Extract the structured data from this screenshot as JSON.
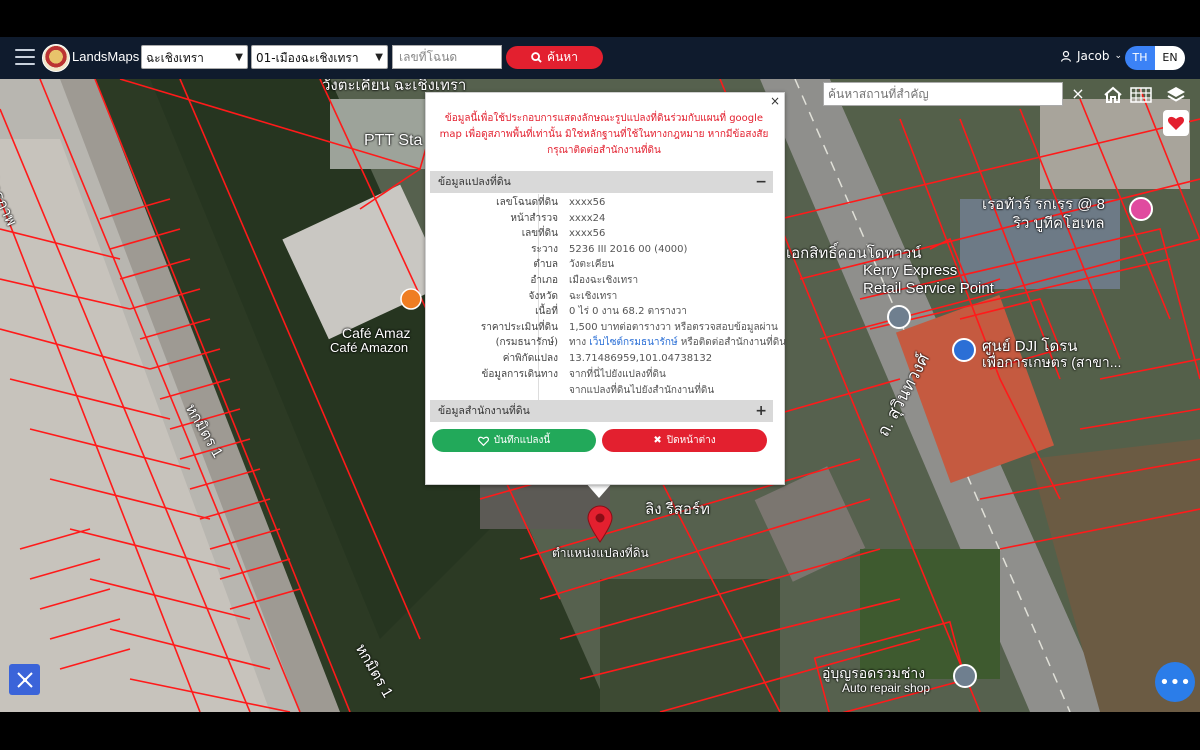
{
  "app": {
    "name": "LandsMaps"
  },
  "toolbar": {
    "province": "ฉะเชิงเทรา",
    "district": "01-เมืองฉะเชิงเทรา",
    "deed_placeholder": "เลขที่โฉนด",
    "search_label": "ค้นหา"
  },
  "user": {
    "name": "Jacob"
  },
  "language": {
    "th": "TH",
    "en": "EN",
    "active": "TH"
  },
  "map_controls": {
    "place_search_placeholder": "ค้นหาสถานที่สำคัญ",
    "clear": "×",
    "chat_label": "•••"
  },
  "map_labels": [
    "วังตะเคียน ฉะเชิงเทรา",
    "PTT Sta",
    "Café Amaz",
    "Café Amazon",
    "มิตรภาพ",
    "หกมิตร 1",
    "หกมิตร 1",
    "เรอทัวร์ รกเรร @ 8",
    "ริว บูทีคโฮเทล",
    "เอกสิทธิ์คอนโดทาวน์",
    "Kerry Express",
    "Retail Service Point",
    "ศูนย์ DJI โดรน",
    "เพื่อการเกษตร (สาขา...",
    "ถ. สุวินทวงศ์",
    "อู่บุญรอดรวมช่าง",
    "Auto repair shop",
    "ลิง รีสอร์ท",
    "ตำแหน่งแปลงที่ดิน"
  ],
  "popup": {
    "close": "×",
    "disclaimer": "ข้อมูลนี้เพื่อใช้ประกอบการแสดงลักษณะรูปแปลงที่ดินร่วมกับแผนที่ google map เพื่อดูสภาพพื้นที่เท่านั้น มิใช่หลักฐานที่ใช้ในทางกฎหมาย หากมีข้อสงสัย กรุณาติดต่อสำนักงานที่ดิน",
    "land_section_title": "ข้อมูลแปลงที่ดิน",
    "land_section_toggle": "−",
    "office_section_title": "ข้อมูลสำนักงานที่ดิน",
    "office_section_toggle": "+",
    "rows": [
      {
        "label": "เลขโฉนดที่ดิน",
        "value": "xxxx56"
      },
      {
        "label": "หน้าสำรวจ",
        "value": "xxxx24"
      },
      {
        "label": "เลขที่ดิน",
        "value": "xxxx56"
      },
      {
        "label": "ระวาง",
        "value": "5236 III 2016 00 (4000)"
      },
      {
        "label": "ตำบล",
        "value": "วังตะเคียน"
      },
      {
        "label": "อำเภอ",
        "value": "เมืองฉะเชิงเทรา"
      },
      {
        "label": "จังหวัด",
        "value": "ฉะเชิงเทรา"
      },
      {
        "label": "เนื้อที่",
        "value": "0 ไร่ 0 งาน 68.2 ตารางวา"
      },
      {
        "label": "ราคาประเมินที่ดิน",
        "value": "1,500 บาทต่อตารางวา หรือตรวจสอบข้อมูลผ่าน"
      }
    ],
    "price_source_label": "(กรมธนารักษ์)",
    "price_line2_prefix": "ทาง",
    "price_line2_link": "เว็บไซต์กรมธนารักษ์",
    "price_line2_suffix": "หรือติดต่อสำนักงานที่ดิน",
    "coords_label": "ค่าพิกัดแปลง",
    "coords_value": "13.71486959,101.04738132",
    "travel_label": "ข้อมูลการเดินทาง",
    "travel_link1": "จากที่นี่ไปยังแปลงที่ดิน",
    "travel_link2": "จากแปลงที่ดินไปยังสำนักงานที่ดิน",
    "save_label": "บันทึกแปลงนี้",
    "close_label": "ปิดหน้าต่าง"
  },
  "colors": {
    "navbar": "#0f1b2d",
    "accent_red": "#e3202f",
    "save_green": "#22a95a",
    "parcel_lines": "#ff1a1a",
    "link_blue": "#2a6fd6"
  }
}
